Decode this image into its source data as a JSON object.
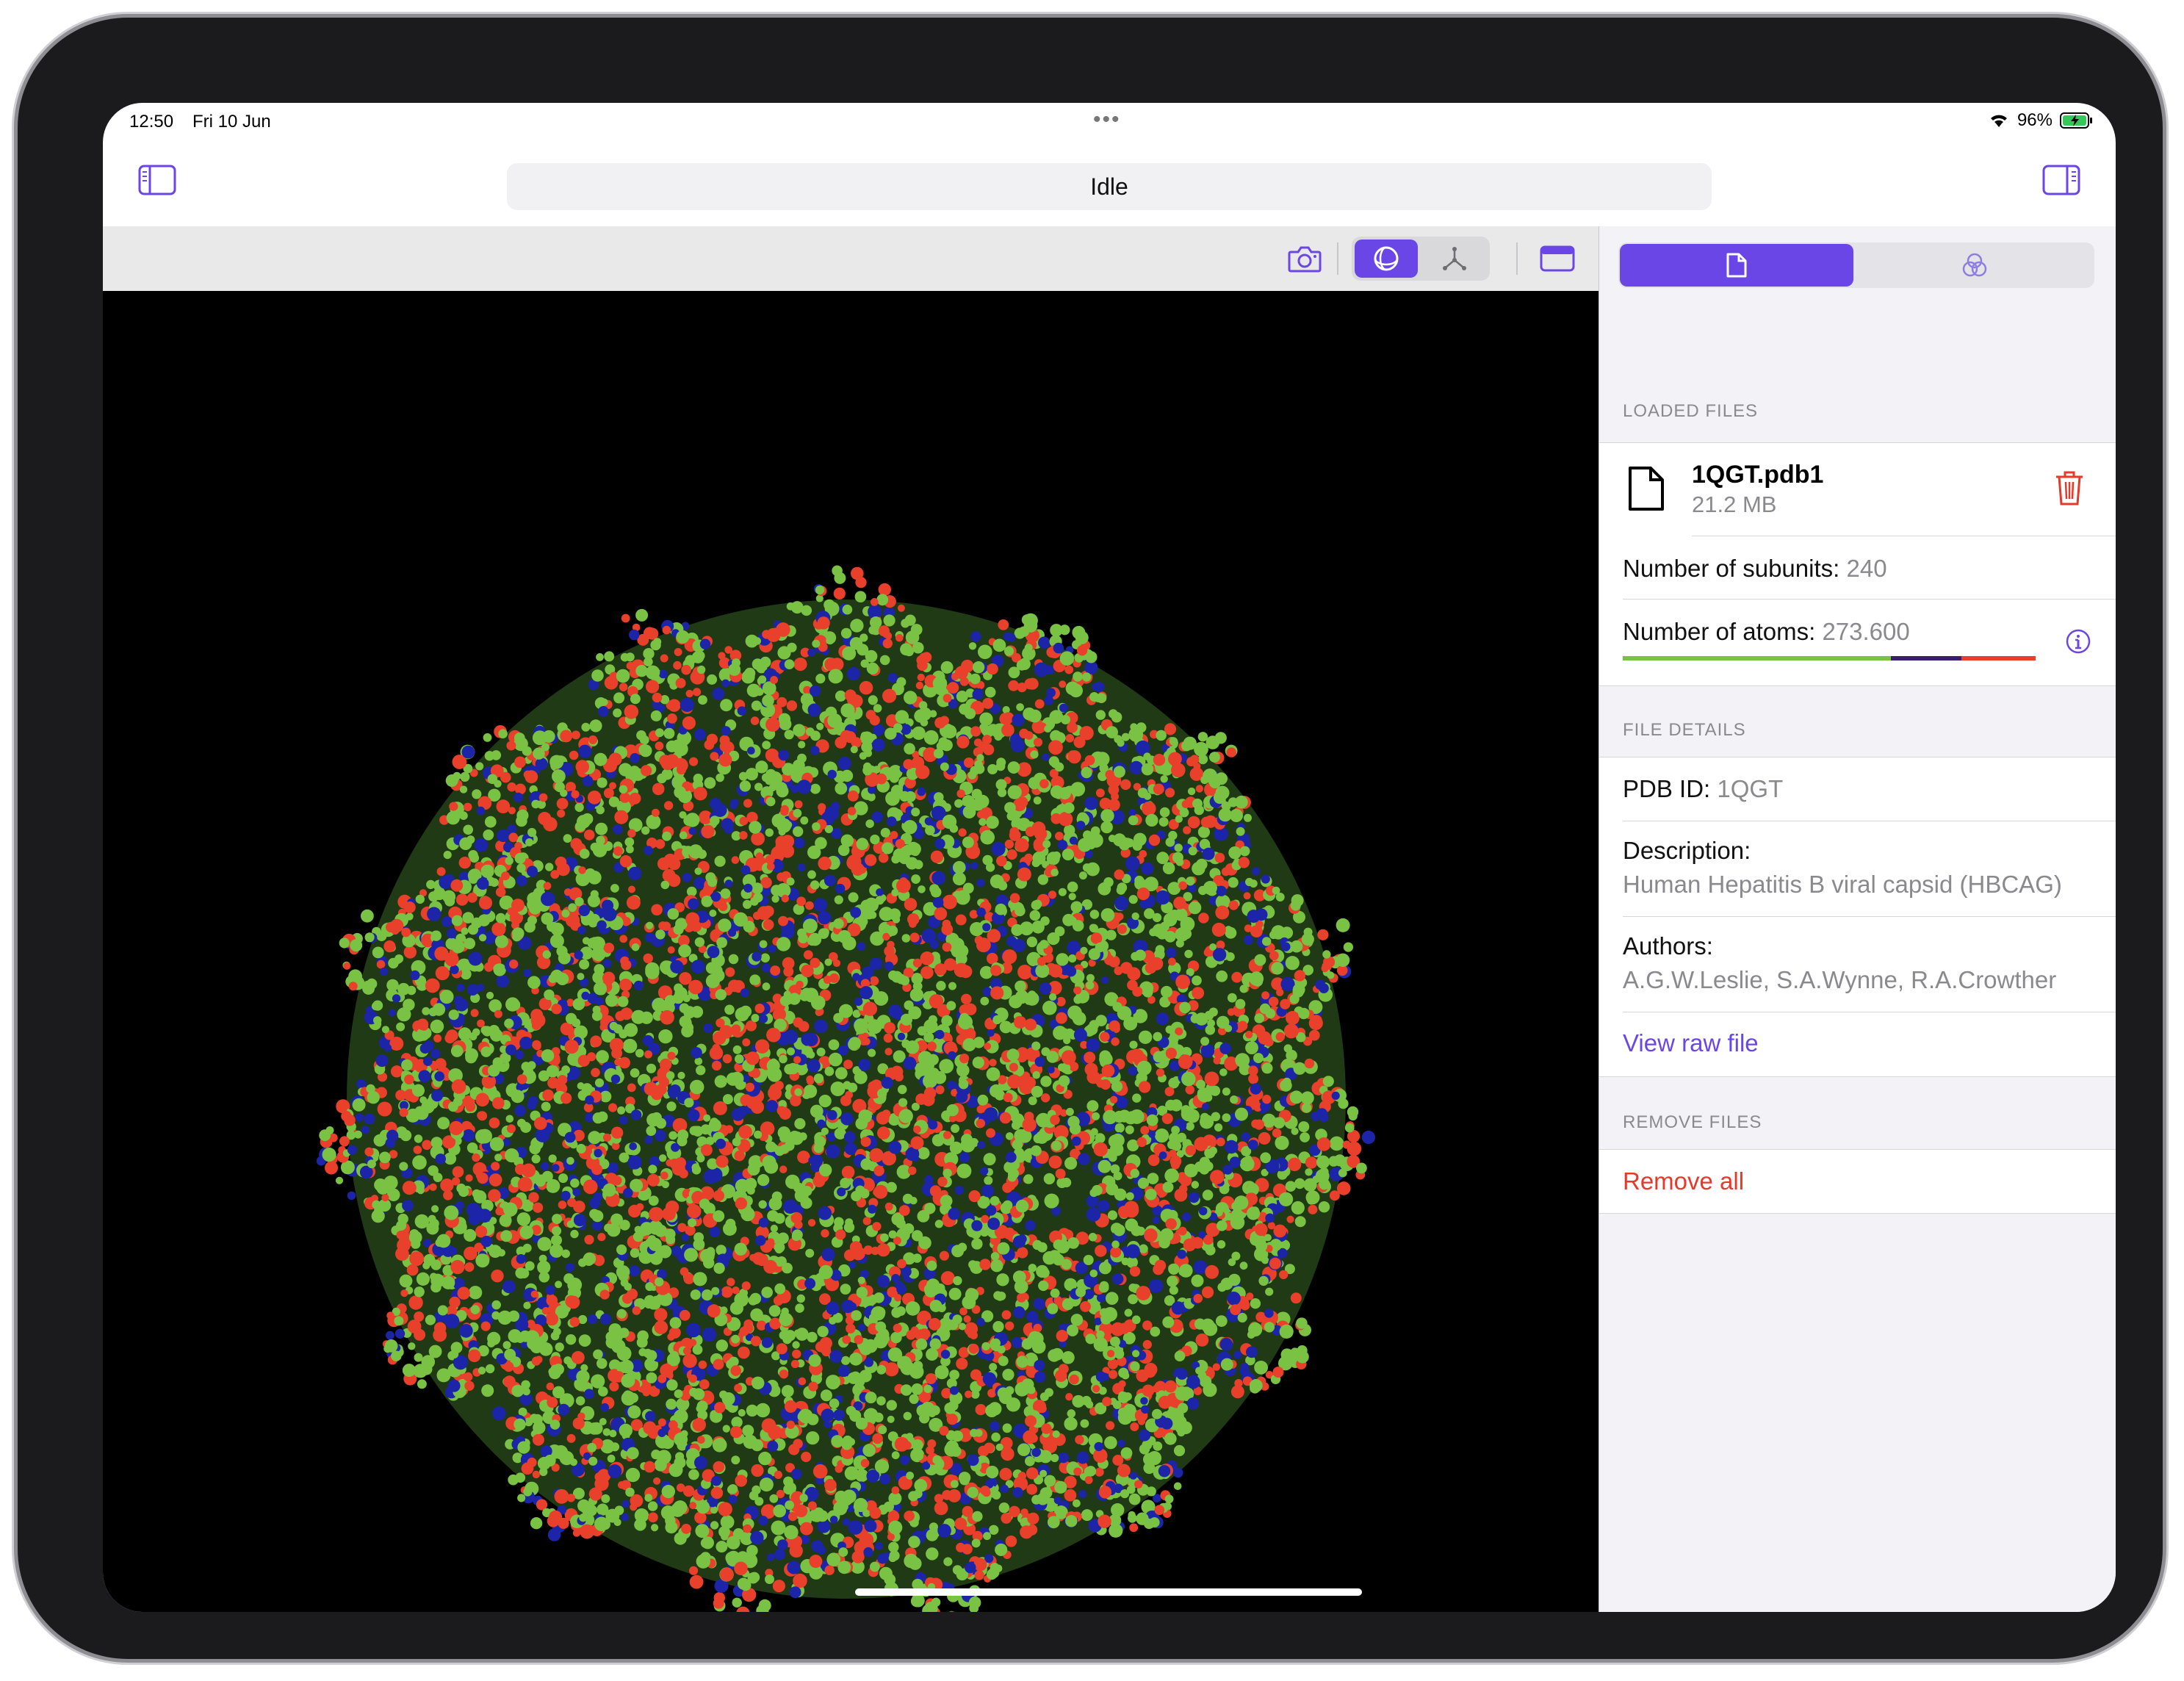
{
  "status_bar": {
    "time": "12:50",
    "date": "Fri 10 Jun",
    "battery": "96%"
  },
  "navbar": {
    "title": "Idle"
  },
  "toolbar": {
    "icons": [
      "sidebar-left-icon",
      "camera-icon",
      "sphere-icon",
      "molecule-graph-icon",
      "window-icon",
      "sidebar-right-icon"
    ]
  },
  "inspector": {
    "tabs": [
      "document-icon",
      "overlap-circles-icon"
    ],
    "loaded_files": {
      "header": "LOADED FILES",
      "file_name": "1QGT.pdb1",
      "file_size": "21.2 MB",
      "subunits_label": "Number of subunits:",
      "subunits_value": "240",
      "atoms_label": "Number of atoms:",
      "atoms_value": "273.600",
      "composition": [
        {
          "color": "#7ac243",
          "fraction": 0.65
        },
        {
          "color": "#3a1e6b",
          "fraction": 0.17
        },
        {
          "color": "#e8402a",
          "fraction": 0.18
        }
      ]
    },
    "file_details": {
      "header": "FILE DETAILS",
      "pdb_label": "PDB ID:",
      "pdb_value": "1QGT",
      "description_label": "Description:",
      "description_value": "Human Hepatitis B viral capsid (HBCAG)",
      "authors_label": "Authors:",
      "authors_value": "A.G.W.Leslie, S.A.Wynne, R.A.Crowther",
      "view_raw": "View raw file"
    },
    "remove_files": {
      "header": "REMOVE FILES",
      "remove_all": "Remove all"
    }
  },
  "colors": {
    "accent": "#6b46e6",
    "danger": "#e53a2a",
    "carbon": "#7ac243",
    "oxygen": "#e8402a",
    "nitrogen": "#1c25a8"
  }
}
